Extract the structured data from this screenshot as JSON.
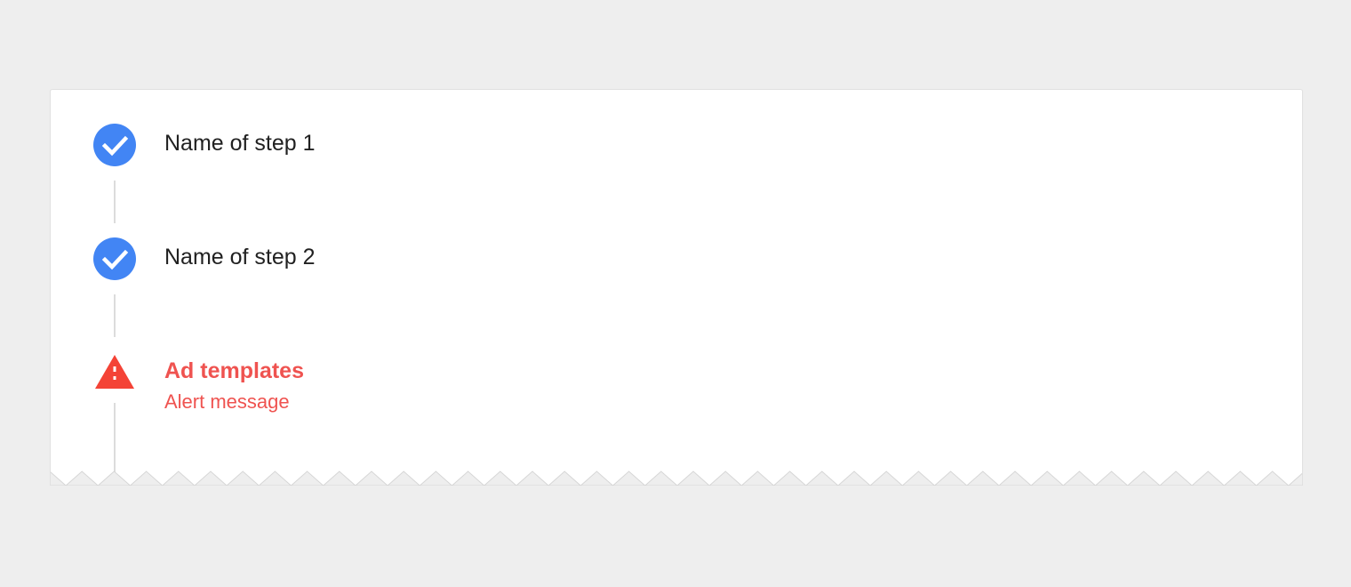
{
  "stepper": {
    "steps": [
      {
        "label": "Name of step 1",
        "status": "complete",
        "icon": "check-circle-icon"
      },
      {
        "label": "Name of step 2",
        "status": "complete",
        "icon": "check-circle-icon"
      },
      {
        "label": "Ad templates",
        "message": "Alert message",
        "status": "alert",
        "icon": "warning-triangle-icon"
      }
    ]
  },
  "colors": {
    "page_background": "#eeeeee",
    "card_background": "#ffffff",
    "complete_icon": "#4285f4",
    "alert": "#ef5350",
    "alert_icon": "#f44336",
    "connector": "#dcdcdc",
    "label_text": "#212121"
  }
}
